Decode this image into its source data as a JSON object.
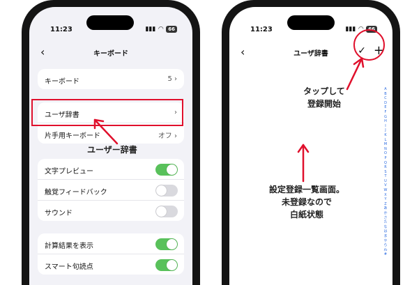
{
  "left_phone": {
    "status": {
      "time": "11:23",
      "battery": "66"
    },
    "nav": {
      "back": "‹",
      "title": "キーボード"
    },
    "groups": [
      {
        "rows": [
          {
            "label": "キーボード",
            "value": "5 ›"
          }
        ]
      },
      {
        "rows": [
          {
            "label": "ユーザ辞書",
            "value": "›"
          },
          {
            "label": "片手用キーボード",
            "value": "オフ ›"
          }
        ]
      },
      {
        "rows": [
          {
            "label": "文字プレビュー",
            "toggle": true
          },
          {
            "label": "触覚フィードバック",
            "toggle": false
          },
          {
            "label": "サウンド",
            "toggle": false
          }
        ]
      },
      {
        "rows": [
          {
            "label": "計算結果を表示",
            "toggle": true
          },
          {
            "label": "スマート句読点",
            "toggle": true
          }
        ]
      }
    ]
  },
  "right_phone": {
    "status": {
      "time": "11:23",
      "battery": "66"
    },
    "nav": {
      "back": "‹",
      "title": "ユーザ辞書",
      "check": "✓",
      "add": "+"
    },
    "index_letters": [
      "A",
      "B",
      "C",
      "D",
      "E",
      "F",
      "G",
      "H",
      "I",
      "J",
      "K",
      "L",
      "M",
      "N",
      "O",
      "P",
      "Q",
      "R",
      "S",
      "T",
      "U",
      "V",
      "W",
      "X",
      "Y",
      "Z",
      "あ",
      "か",
      "さ",
      "た",
      "な",
      "は",
      "ま",
      "や",
      "ら",
      "わ",
      "#"
    ]
  },
  "annotations": {
    "user_dict": "ユーザー辞書",
    "tap_line1": "タップして",
    "tap_line2": "登録開始",
    "empty_line1": "設定登録一覧画面。",
    "empty_line2": "未登録なので",
    "empty_line3": "白紙状態"
  },
  "colors": {
    "highlight": "#e0102c",
    "toggle_on": "#59c15b",
    "index": "#2a6ae0"
  }
}
